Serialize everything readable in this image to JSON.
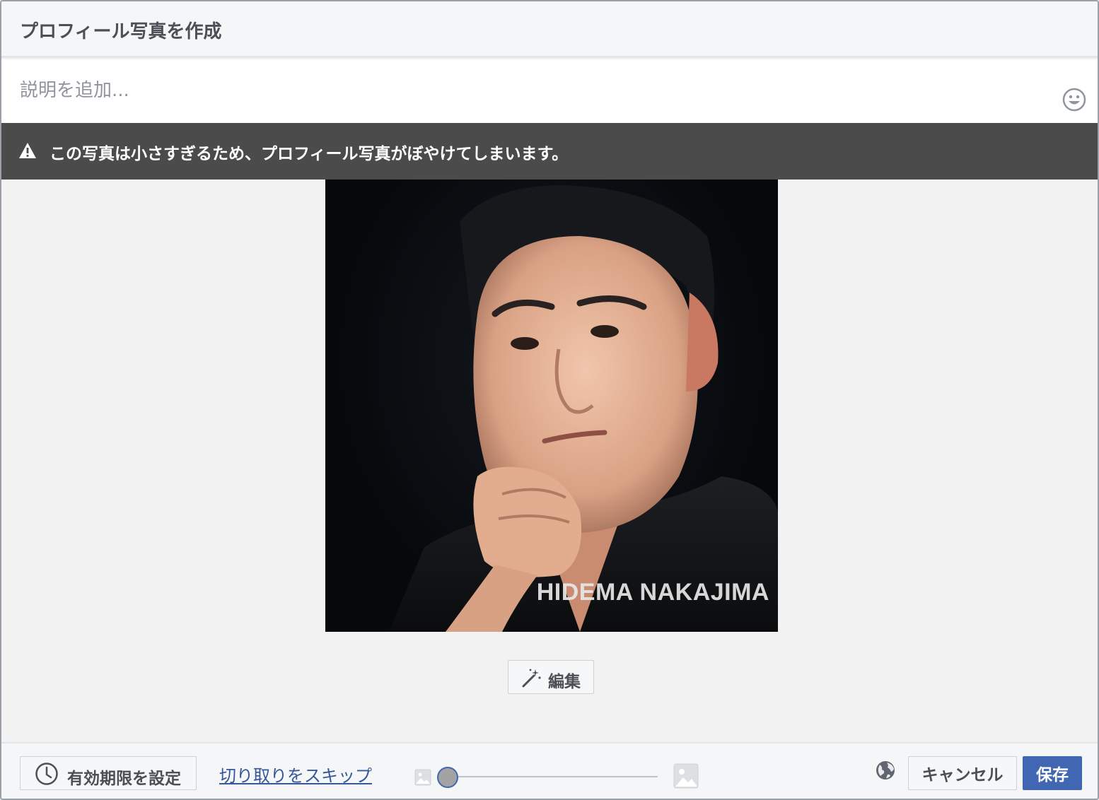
{
  "dialog": {
    "title": "プロフィール写真を作成",
    "description_placeholder": "説明を追加...",
    "warning_text": "この写真は小さすぎるため、プロフィール写真がぼやけてしまいます。",
    "photo_watermark": "HIDEMA NAKAJIMA",
    "edit_label": "編集"
  },
  "footer": {
    "expire_label": "有効期限を設定",
    "skip_crop_label": "切り取りをスキップ",
    "zoom_level": 0,
    "privacy_icon": "globe-icon",
    "cancel_label": "キャンセル",
    "save_label": "保存"
  },
  "colors": {
    "accent": "#4267b2",
    "link": "#365899",
    "warning_bar": "#4b4b4b",
    "header_bg": "#f5f6f7"
  },
  "icons": [
    "smiley-icon",
    "warning-icon",
    "magic-wand-icon",
    "clock-icon",
    "image-small-icon",
    "image-large-icon",
    "globe-icon"
  ]
}
